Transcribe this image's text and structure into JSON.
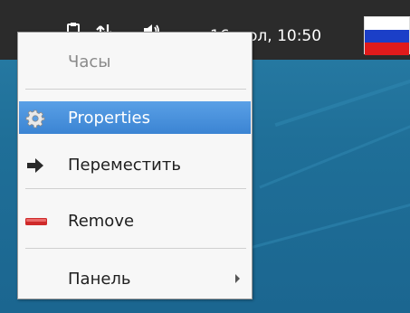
{
  "panel": {
    "clock_text": "16 июл, 10:50",
    "tray_icons": [
      "speaker-icon",
      "network-icon",
      "clipboard-icon"
    ],
    "keyboard_layout_flag": "russian-flag",
    "colors": {
      "panel_bg": "#2b2b2b",
      "flag_white": "#ffffff",
      "flag_blue": "#1b3fc8",
      "flag_red": "#e01b1b"
    }
  },
  "context_menu": {
    "title": "Часы",
    "items": [
      {
        "label": "Properties",
        "icon": "gear-icon",
        "selected": true,
        "mnemonic": "P"
      },
      {
        "label": "Переместить",
        "icon": "arrow-right-icon",
        "selected": false,
        "mnemonic": "П"
      },
      {
        "label": "Remove",
        "icon": "minus-icon",
        "selected": false,
        "mnemonic": "R"
      },
      {
        "label": "Панель",
        "icon": "",
        "selected": false,
        "mnemonic": "л",
        "has_submenu": true
      }
    ],
    "colors": {
      "selection": "#3b84d3",
      "remove_icon": "#cf2a2a"
    }
  }
}
